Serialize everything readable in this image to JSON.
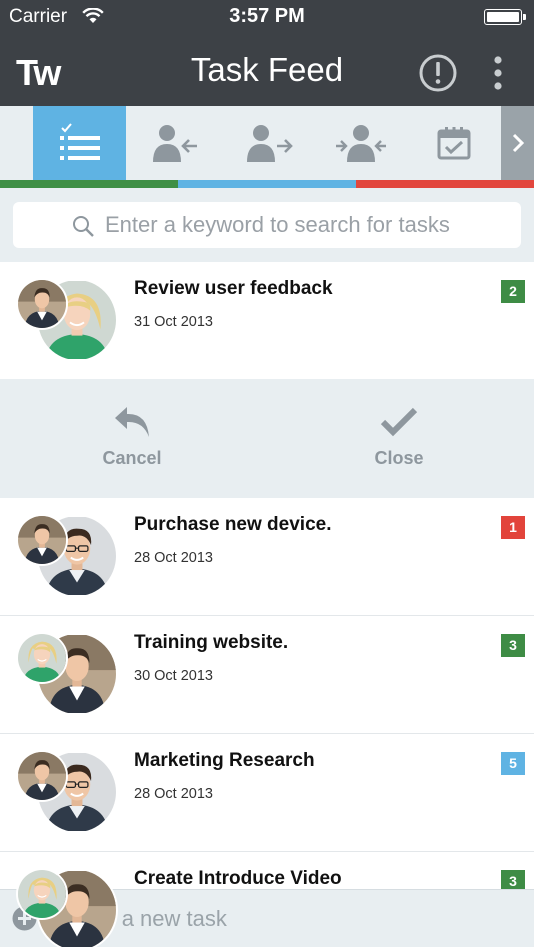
{
  "status_bar": {
    "carrier": "Carrier",
    "time": "3:57 PM"
  },
  "header": {
    "logo": "Tw",
    "title": "Task Feed"
  },
  "tabs": [
    {
      "icon": "task-list-icon",
      "active": true
    },
    {
      "icon": "user-incoming-icon",
      "active": false
    },
    {
      "icon": "user-outgoing-icon",
      "active": false
    },
    {
      "icon": "user-swap-icon",
      "active": false
    },
    {
      "icon": "calendar-check-icon",
      "active": false
    }
  ],
  "tab_stripe_colors": [
    "#3f8f46",
    "#5fb3e3",
    "#e2463d"
  ],
  "search": {
    "placeholder": "Enter a keyword to search for tasks"
  },
  "tasks": [
    {
      "title": "Review user feedback",
      "date": "31 Oct 2013",
      "badge": "2",
      "badge_color": "#3e8c45"
    },
    {
      "title": "Purchase new device.",
      "date": "28 Oct 2013",
      "badge": "1",
      "badge_color": "#e2443b"
    },
    {
      "title": "Training website.",
      "date": "30 Oct 2013",
      "badge": "3",
      "badge_color": "#3e8c45"
    },
    {
      "title": "Marketing Research",
      "date": "28 Oct 2013",
      "badge": "5",
      "badge_color": "#5fb3e3"
    },
    {
      "title": "Create Introduce Video",
      "date": "",
      "badge": "3",
      "badge_color": "#3e8c45"
    }
  ],
  "actions": {
    "cancel_label": "Cancel",
    "close_label": "Close"
  },
  "new_task": {
    "placeholder": "Enter a new task"
  }
}
